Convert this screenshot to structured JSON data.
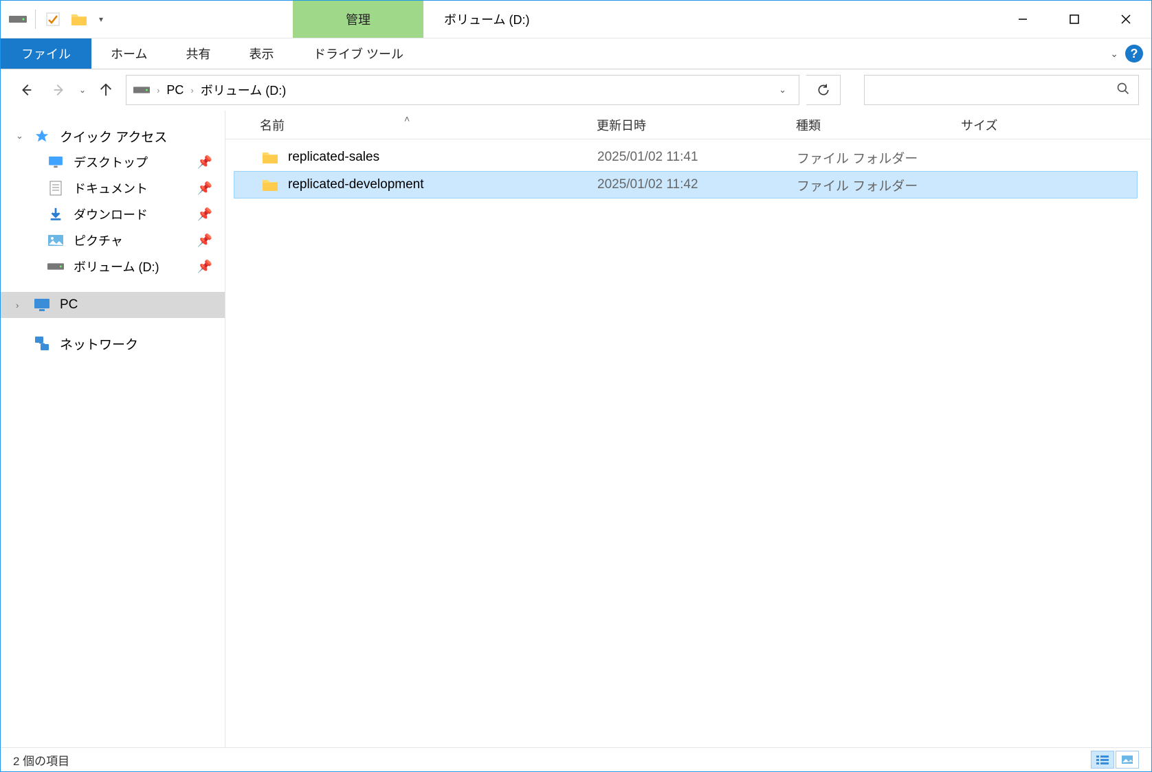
{
  "title": "ボリューム (D:)",
  "context_tab_header": "管理",
  "ribbon": {
    "file": "ファイル",
    "home": "ホーム",
    "share": "共有",
    "view": "表示",
    "drive_tools": "ドライブ ツール"
  },
  "breadcrumb": {
    "pc": "PC",
    "current": "ボリューム (D:)"
  },
  "sidebar": {
    "quick_access": "クイック アクセス",
    "desktop": "デスクトップ",
    "documents": "ドキュメント",
    "downloads": "ダウンロード",
    "pictures": "ピクチャ",
    "volume_d": "ボリューム (D:)",
    "pc": "PC",
    "network": "ネットワーク"
  },
  "columns": {
    "name": "名前",
    "date": "更新日時",
    "type": "種類",
    "size": "サイズ"
  },
  "rows": [
    {
      "name": "replicated-sales",
      "date": "2025/01/02 11:41",
      "type": "ファイル フォルダー",
      "size": "",
      "selected": false
    },
    {
      "name": "replicated-development",
      "date": "2025/01/02 11:42",
      "type": "ファイル フォルダー",
      "size": "",
      "selected": true
    }
  ],
  "status": "2 個の項目"
}
